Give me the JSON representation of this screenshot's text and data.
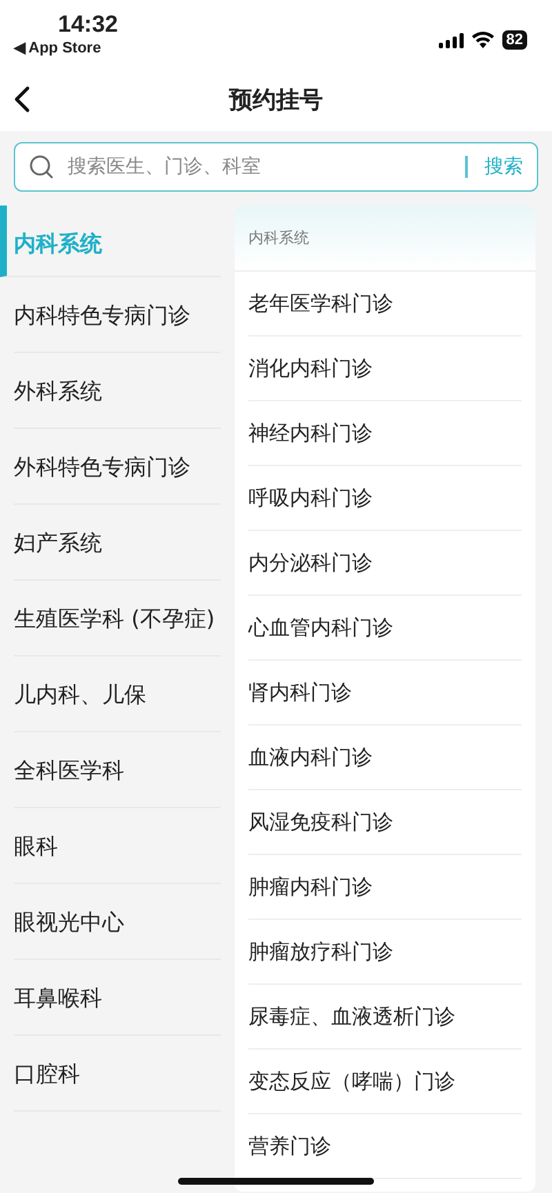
{
  "status_bar": {
    "time": "14:32",
    "back_app": "◀ App Store",
    "battery": "82"
  },
  "nav": {
    "title": "预约挂号"
  },
  "search": {
    "placeholder": "搜索医生、门诊、科室",
    "button": "搜索"
  },
  "categories": [
    {
      "label": "内科系统",
      "selected": true
    },
    {
      "label": "内科特色专病门诊",
      "selected": false
    },
    {
      "label": "外科系统",
      "selected": false
    },
    {
      "label": "外科特色专病门诊",
      "selected": false
    },
    {
      "label": "妇产系统",
      "selected": false
    },
    {
      "label": "生殖医学科 (不孕症)",
      "selected": false
    },
    {
      "label": "儿内科、儿保",
      "selected": false
    },
    {
      "label": "全科医学科",
      "selected": false
    },
    {
      "label": "眼科",
      "selected": false
    },
    {
      "label": "眼视光中心",
      "selected": false
    },
    {
      "label": "耳鼻喉科",
      "selected": false
    },
    {
      "label": "口腔科",
      "selected": false
    }
  ],
  "clinics": {
    "header": "内科系统",
    "items": [
      "老年医学科门诊",
      "消化内科门诊",
      "神经内科门诊",
      "呼吸内科门诊",
      "内分泌科门诊",
      "心血管内科门诊",
      "肾内科门诊",
      "血液内科门诊",
      "风湿免疫科门诊",
      "肿瘤内科门诊",
      "肿瘤放疗科门诊",
      "尿毒症、血液透析门诊",
      "变态反应（哮喘）门诊",
      "营养门诊"
    ]
  }
}
